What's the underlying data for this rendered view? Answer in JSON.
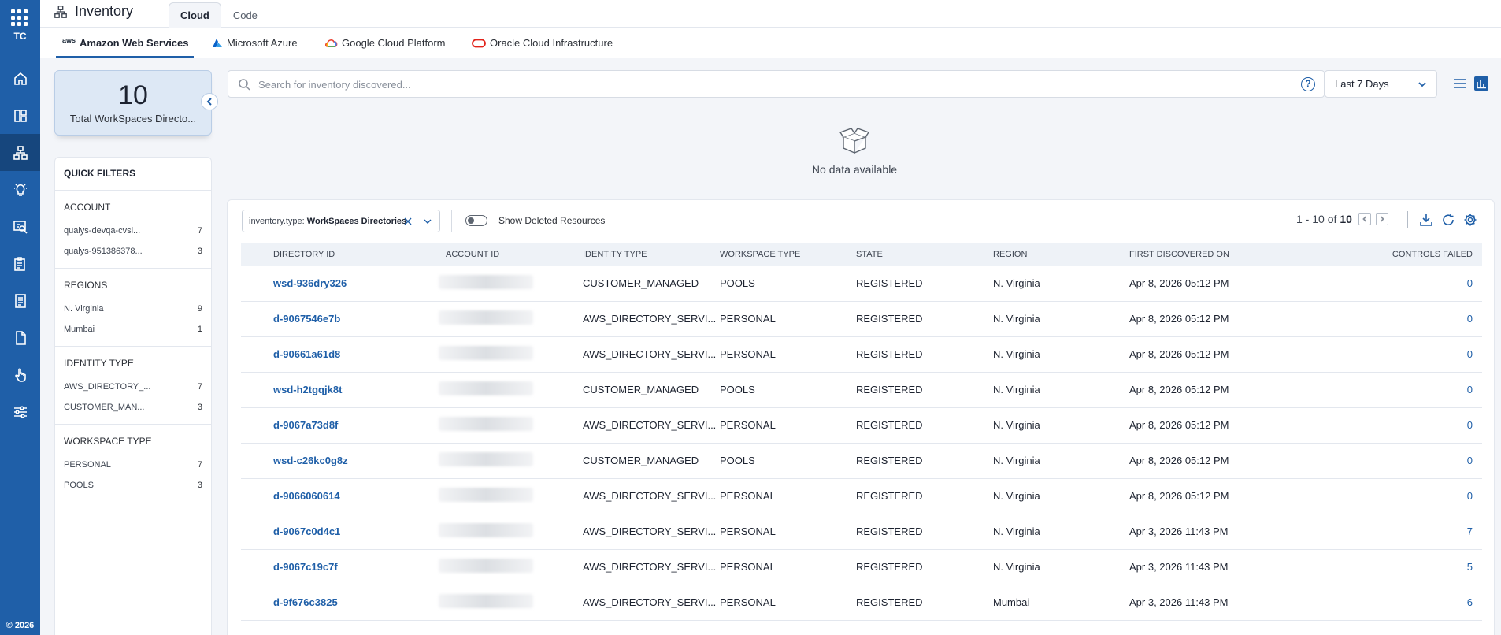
{
  "rail": {
    "initials": "TC",
    "copyright": "© 2026",
    "icons": [
      "apps-grid-icon",
      "home-icon",
      "dashboard-icon",
      "inventory-icon",
      "insights-icon",
      "search-detections-icon",
      "assessment-icon",
      "reports-icon",
      "document-icon",
      "remediation-hand-icon",
      "settings-sliders-icon"
    ]
  },
  "header": {
    "title": "Inventory",
    "tabs": [
      {
        "label": "Cloud",
        "active": true
      },
      {
        "label": "Code",
        "active": false
      }
    ]
  },
  "providers": [
    {
      "label": "Amazon Web Services",
      "logo": "aws",
      "active": true
    },
    {
      "label": "Microsoft Azure",
      "logo": "azure",
      "active": false
    },
    {
      "label": "Google Cloud Platform",
      "logo": "gcp",
      "active": false
    },
    {
      "label": "Oracle Cloud Infrastructure",
      "logo": "oci",
      "active": false
    }
  ],
  "summary": {
    "count": "10",
    "label": "Total WorkSpaces Directo..."
  },
  "quick_filters": {
    "title": "QUICK FILTERS",
    "groups": [
      {
        "title": "ACCOUNT",
        "items": [
          {
            "label": "qualys-devqa-cvsi...",
            "count": "7"
          },
          {
            "label": "qualys-951386378...",
            "count": "3"
          }
        ]
      },
      {
        "title": "REGIONS",
        "items": [
          {
            "label": "N. Virginia",
            "count": "9"
          },
          {
            "label": "Mumbai",
            "count": "1"
          }
        ]
      },
      {
        "title": "IDENTITY TYPE",
        "items": [
          {
            "label": "AWS_DIRECTORY_...",
            "count": "7"
          },
          {
            "label": "CUSTOMER_MAN...",
            "count": "3"
          }
        ]
      },
      {
        "title": "WORKSPACE TYPE",
        "items": [
          {
            "label": "PERSONAL",
            "count": "7"
          },
          {
            "label": "POOLS",
            "count": "3"
          }
        ]
      }
    ]
  },
  "search": {
    "placeholder": "Search for inventory discovered...",
    "help": "?"
  },
  "period": {
    "selected": "Last 7 Days"
  },
  "no_data": "No data available",
  "filter_chip": {
    "key": "inventory.type:",
    "value": "WorkSpaces Directories"
  },
  "show_deleted": "Show Deleted Resources",
  "pager": {
    "range": "1 - 10 of",
    "total": "10"
  },
  "table": {
    "headers": [
      "DIRECTORY ID",
      "ACCOUNT ID",
      "IDENTITY TYPE",
      "WORKSPACE TYPE",
      "STATE",
      "REGION",
      "FIRST DISCOVERED ON",
      "CONTROLS FAILED"
    ],
    "rows": [
      [
        "wsd-936dry326",
        "",
        "CUSTOMER_MANAGED",
        "POOLS",
        "REGISTERED",
        "N. Virginia",
        "Apr 8, 2026 05:12 PM",
        "0"
      ],
      [
        "d-9067546e7b",
        "",
        "AWS_DIRECTORY_SERVI...",
        "PERSONAL",
        "REGISTERED",
        "N. Virginia",
        "Apr 8, 2026 05:12 PM",
        "0"
      ],
      [
        "d-90661a61d8",
        "",
        "AWS_DIRECTORY_SERVI...",
        "PERSONAL",
        "REGISTERED",
        "N. Virginia",
        "Apr 8, 2026 05:12 PM",
        "0"
      ],
      [
        "wsd-h2tgqjk8t",
        "",
        "CUSTOMER_MANAGED",
        "POOLS",
        "REGISTERED",
        "N. Virginia",
        "Apr 8, 2026 05:12 PM",
        "0"
      ],
      [
        "d-9067a73d8f",
        "",
        "AWS_DIRECTORY_SERVI...",
        "PERSONAL",
        "REGISTERED",
        "N. Virginia",
        "Apr 8, 2026 05:12 PM",
        "0"
      ],
      [
        "wsd-c26kc0g8z",
        "",
        "CUSTOMER_MANAGED",
        "POOLS",
        "REGISTERED",
        "N. Virginia",
        "Apr 8, 2026 05:12 PM",
        "0"
      ],
      [
        "d-9066060614",
        "",
        "AWS_DIRECTORY_SERVI...",
        "PERSONAL",
        "REGISTERED",
        "N. Virginia",
        "Apr 8, 2026 05:12 PM",
        "0"
      ],
      [
        "d-9067c0d4c1",
        "",
        "AWS_DIRECTORY_SERVI...",
        "PERSONAL",
        "REGISTERED",
        "N. Virginia",
        "Apr 3, 2026 11:43 PM",
        "7"
      ],
      [
        "d-9067c19c7f",
        "",
        "AWS_DIRECTORY_SERVI...",
        "PERSONAL",
        "REGISTERED",
        "N. Virginia",
        "Apr 3, 2026 11:43 PM",
        "5"
      ],
      [
        "d-9f676c3825",
        "",
        "AWS_DIRECTORY_SERVI...",
        "PERSONAL",
        "REGISTERED",
        "Mumbai",
        "Apr 3, 2026 11:43 PM",
        "6"
      ]
    ]
  },
  "colors": {
    "brand": "#1f5fa8",
    "rail_active": "#16467d",
    "summary_bg": "#dde8f5"
  }
}
